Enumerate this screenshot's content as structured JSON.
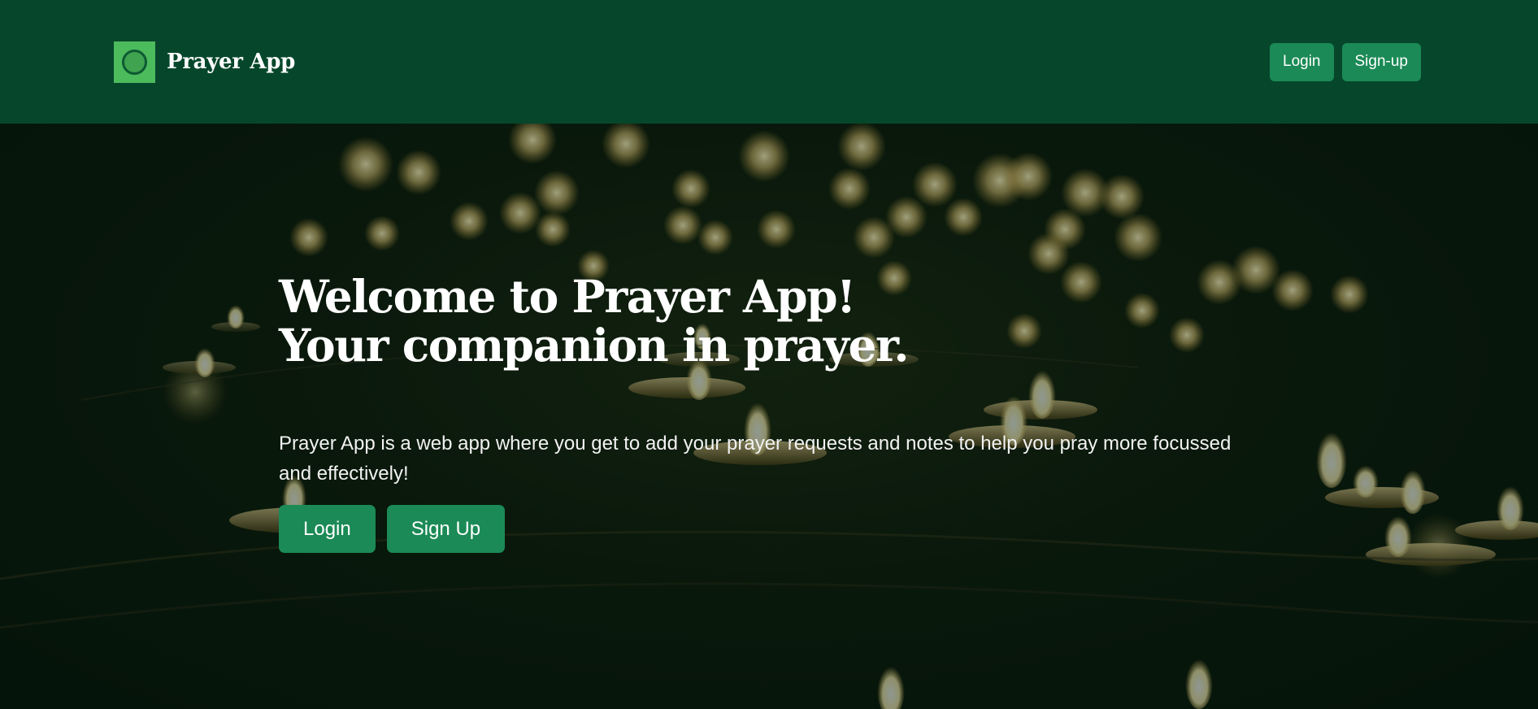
{
  "navbar": {
    "brand_name": "Prayer App",
    "logo_icon": "circle-logo-icon",
    "login_label": "Login",
    "signup_label": "Sign-up"
  },
  "hero": {
    "title_line1": "Welcome to Prayer App!",
    "title_line2": "Your companion in prayer.",
    "description": "Prayer App is a web app where you get to add your prayer requests and notes to help you pray more focussed and effectively!",
    "login_label": "Login",
    "signup_label": "Sign Up",
    "background_image": "candles-background-image"
  },
  "colors": {
    "navbar_bg": "#06472b",
    "button_bg": "#1b8a56",
    "logo_green": "#4cbb5c",
    "text": "#ffffff"
  }
}
